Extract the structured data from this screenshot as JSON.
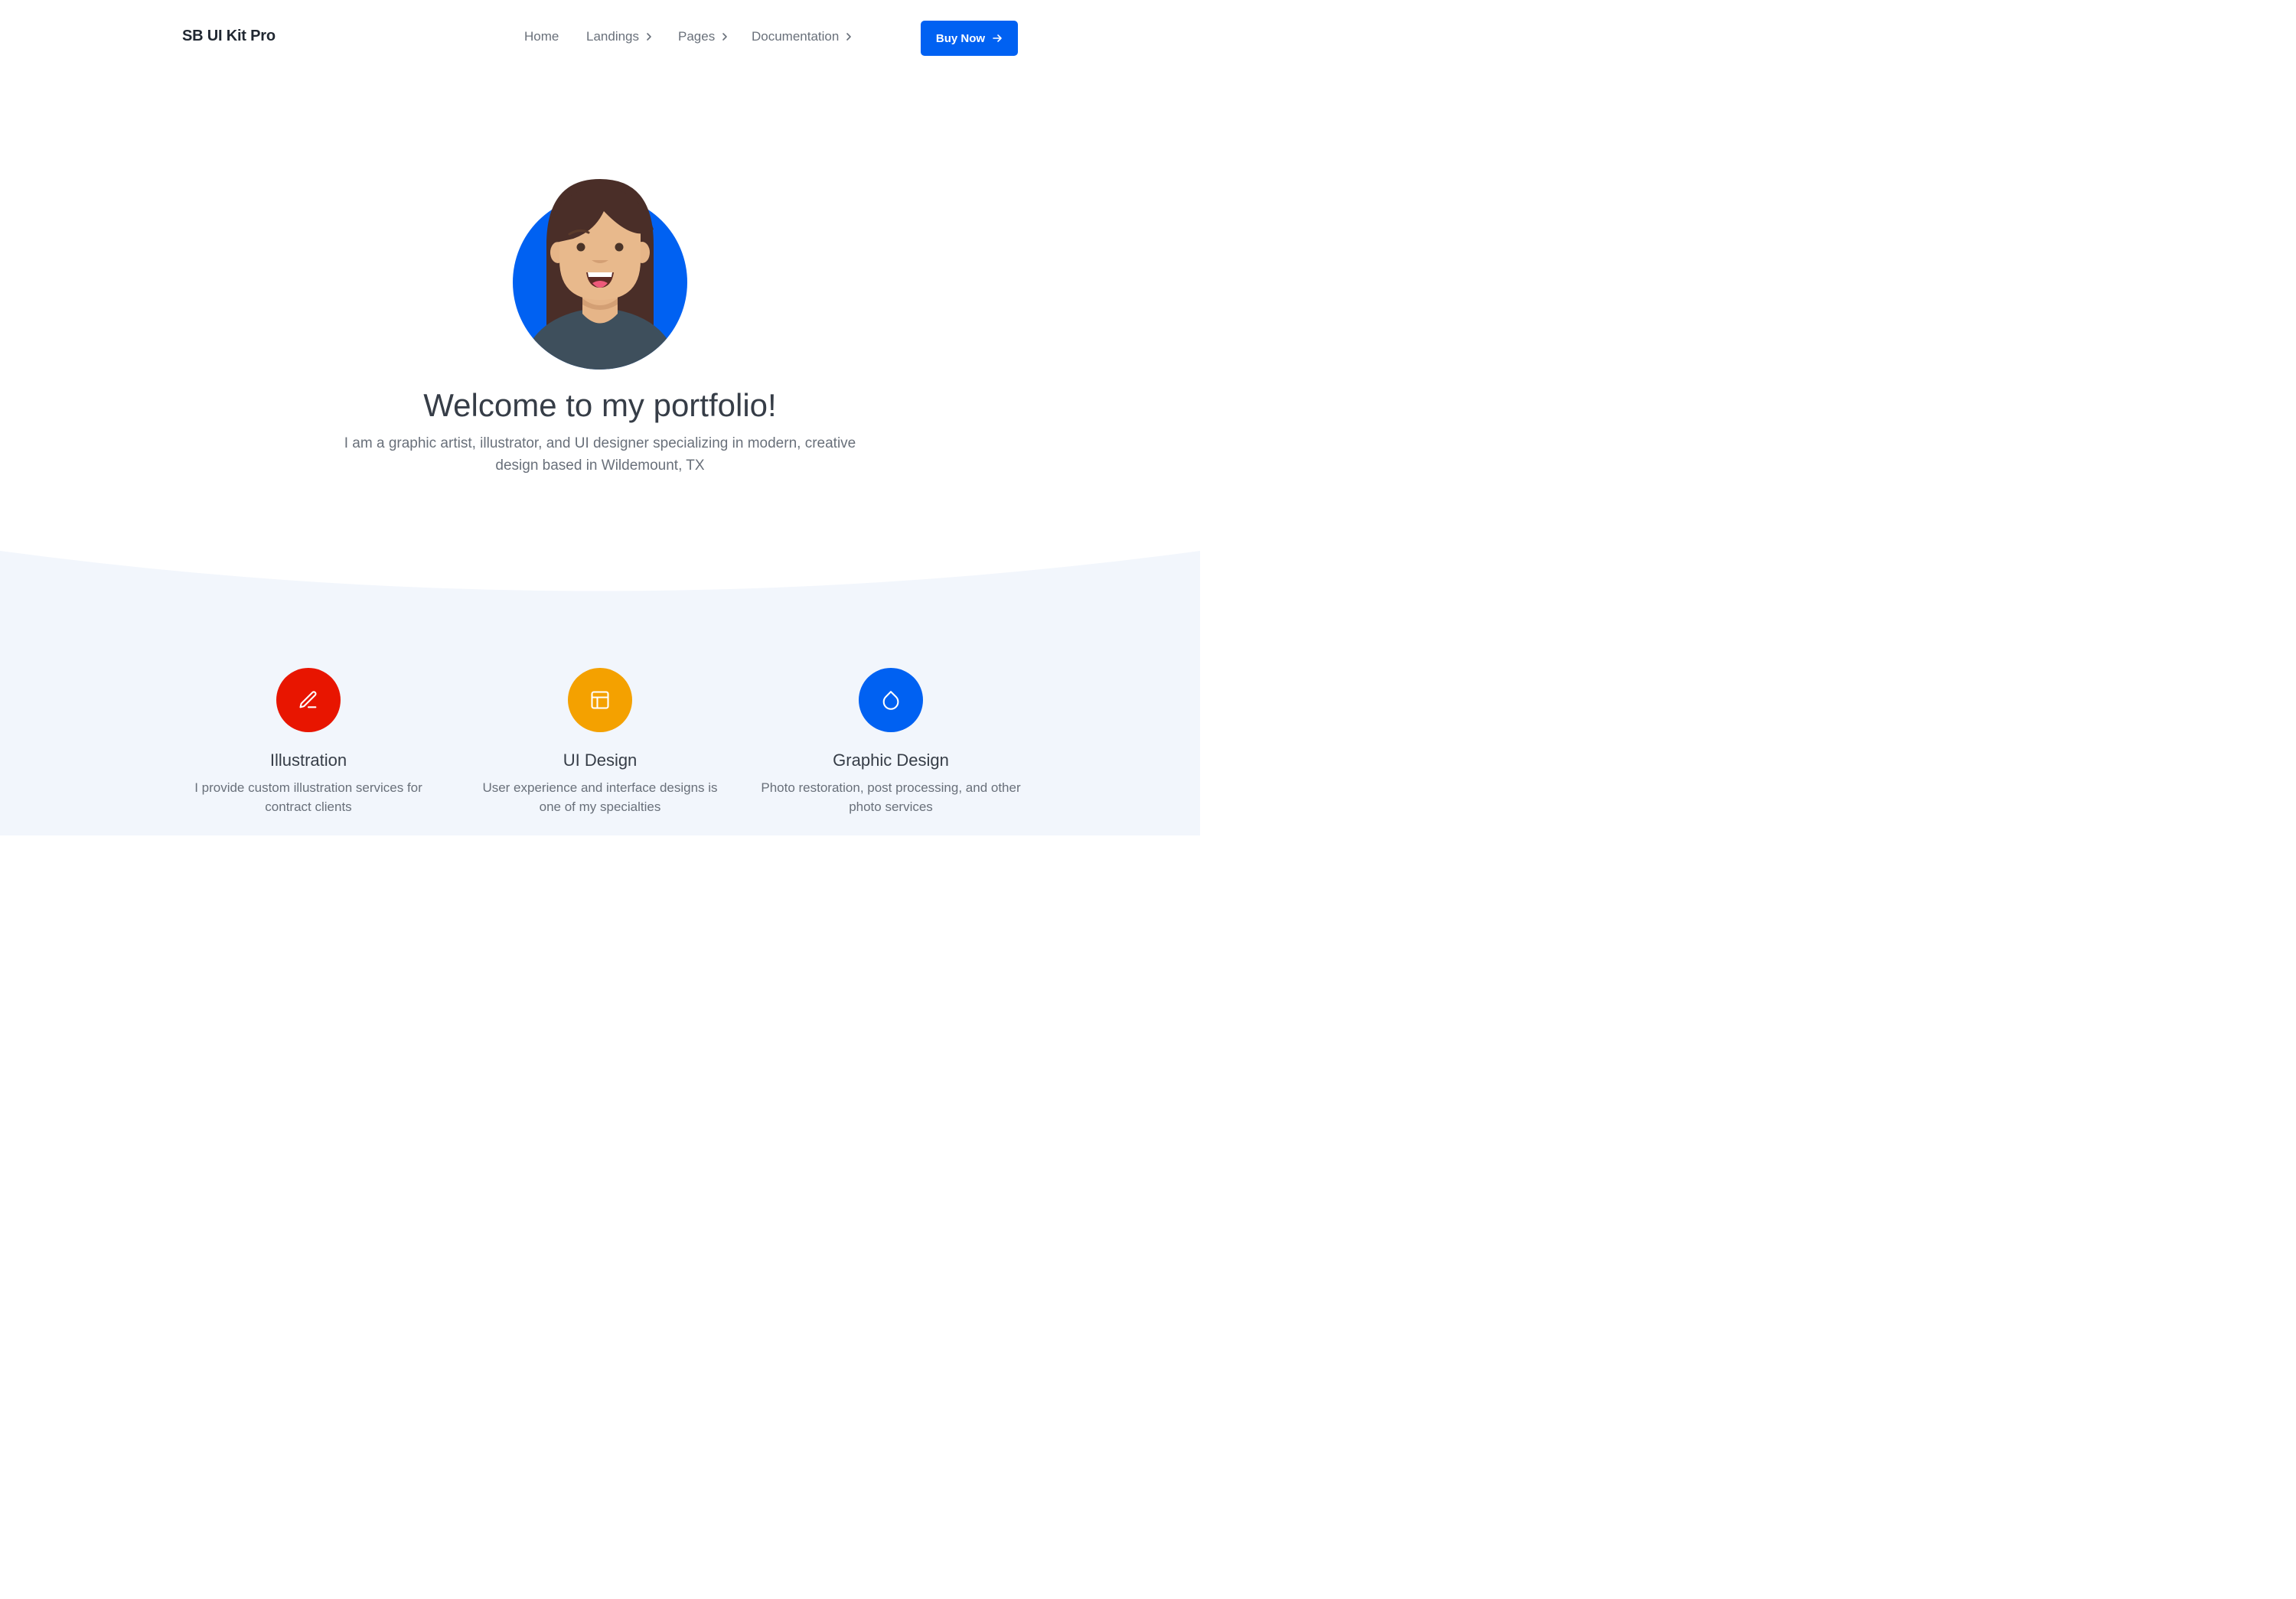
{
  "navbar": {
    "brand": "SB UI Kit Pro",
    "items": [
      {
        "label": "Home",
        "has_dropdown": false
      },
      {
        "label": "Landings",
        "has_dropdown": true
      },
      {
        "label": "Pages",
        "has_dropdown": true
      },
      {
        "label": "Documentation",
        "has_dropdown": true
      }
    ],
    "cta_label": "Buy Now",
    "cta_icon": "arrow-right-icon"
  },
  "hero": {
    "avatar_icon": "avatar-illustration",
    "title": "Welcome to my portfolio!",
    "subtitle": "I am a graphic artist, illustrator, and UI designer specializing in modern, creative design based in Wildemount, TX"
  },
  "features": [
    {
      "icon": "pen-tool-icon",
      "color": "#e81500",
      "title": "Illustration",
      "description": "I provide custom illustration services for contract clients"
    },
    {
      "icon": "layout-icon",
      "color": "#f4a100",
      "title": "UI Design",
      "description": "User experience and interface designs is one of my specialties"
    },
    {
      "icon": "droplet-icon",
      "color": "#0061f2",
      "title": "Graphic Design",
      "description": "Photo restoration, post processing, and other photo services"
    }
  ],
  "colors": {
    "primary": "#0061f2",
    "section_bg": "#f2f6fc",
    "heading": "#363d47",
    "muted": "#69707a"
  }
}
